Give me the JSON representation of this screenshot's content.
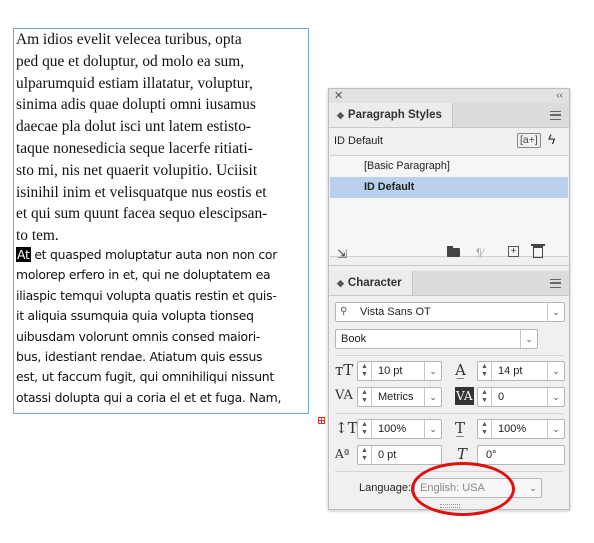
{
  "document": {
    "paragraph1_lines": [
      "Am idios evelit velecea turibus, opta",
      "ped que et doluptur, od molo ea sum,",
      "ulparumquid estiam illatatur, voluptur,",
      "sinima adis quae dolupti omni iusamus",
      "daecae pla dolut isci unt latem estisto-",
      "taque nonesedicia seque lacerfe ritiati-",
      "sto mi, nis net quaerit volupitio. Uciisit",
      "isinihil inim et velisquatque nus eostis et",
      "et qui sum quunt facea sequo elescipsan-",
      "to tem."
    ],
    "paragraph2_selected": "At",
    "paragraph2_first_rest": " et quasped moluptatur auta non non cor",
    "paragraph2_lines": [
      "molorep erfero in et, qui ne doluptatem ea",
      "iliaspic temqui volupta quatis restin et quis-",
      "it aliquia ssumquia quia volupta tionseq",
      "uibusdam volorunt omnis consed maiori-",
      "bus, idestiant rendae. Atiatum quis essus",
      "est, ut faccum fugit, qui omnihiliqui nissunt",
      "otassi dolupta qui a coria el et et fuga. Nam,"
    ]
  },
  "panel": {
    "close_glyph": "✕",
    "collapse_glyph": "‹‹",
    "paragraph_styles": {
      "tab_label": "Paragraph Styles",
      "current_style": "ID Default",
      "quick_apply_label": "[a+]",
      "items": [
        {
          "label": "[Basic Paragraph]",
          "selected": false
        },
        {
          "label": "ID Default",
          "selected": true
        }
      ]
    },
    "character": {
      "tab_label": "Character",
      "font_family": "Vista Sans OT",
      "font_style": "Book",
      "font_size": "10 pt",
      "leading": "14 pt",
      "kerning": "Metrics",
      "tracking": "0",
      "vertical_scale": "100%",
      "horizontal_scale": "100%",
      "baseline_shift": "0 pt",
      "skew": "0°",
      "language_label": "Language:",
      "language": "English: USA"
    }
  },
  "colors": {
    "selection": "#b9d1ee",
    "annotation": "#e01010",
    "frame_border": "#6fa8dc"
  }
}
